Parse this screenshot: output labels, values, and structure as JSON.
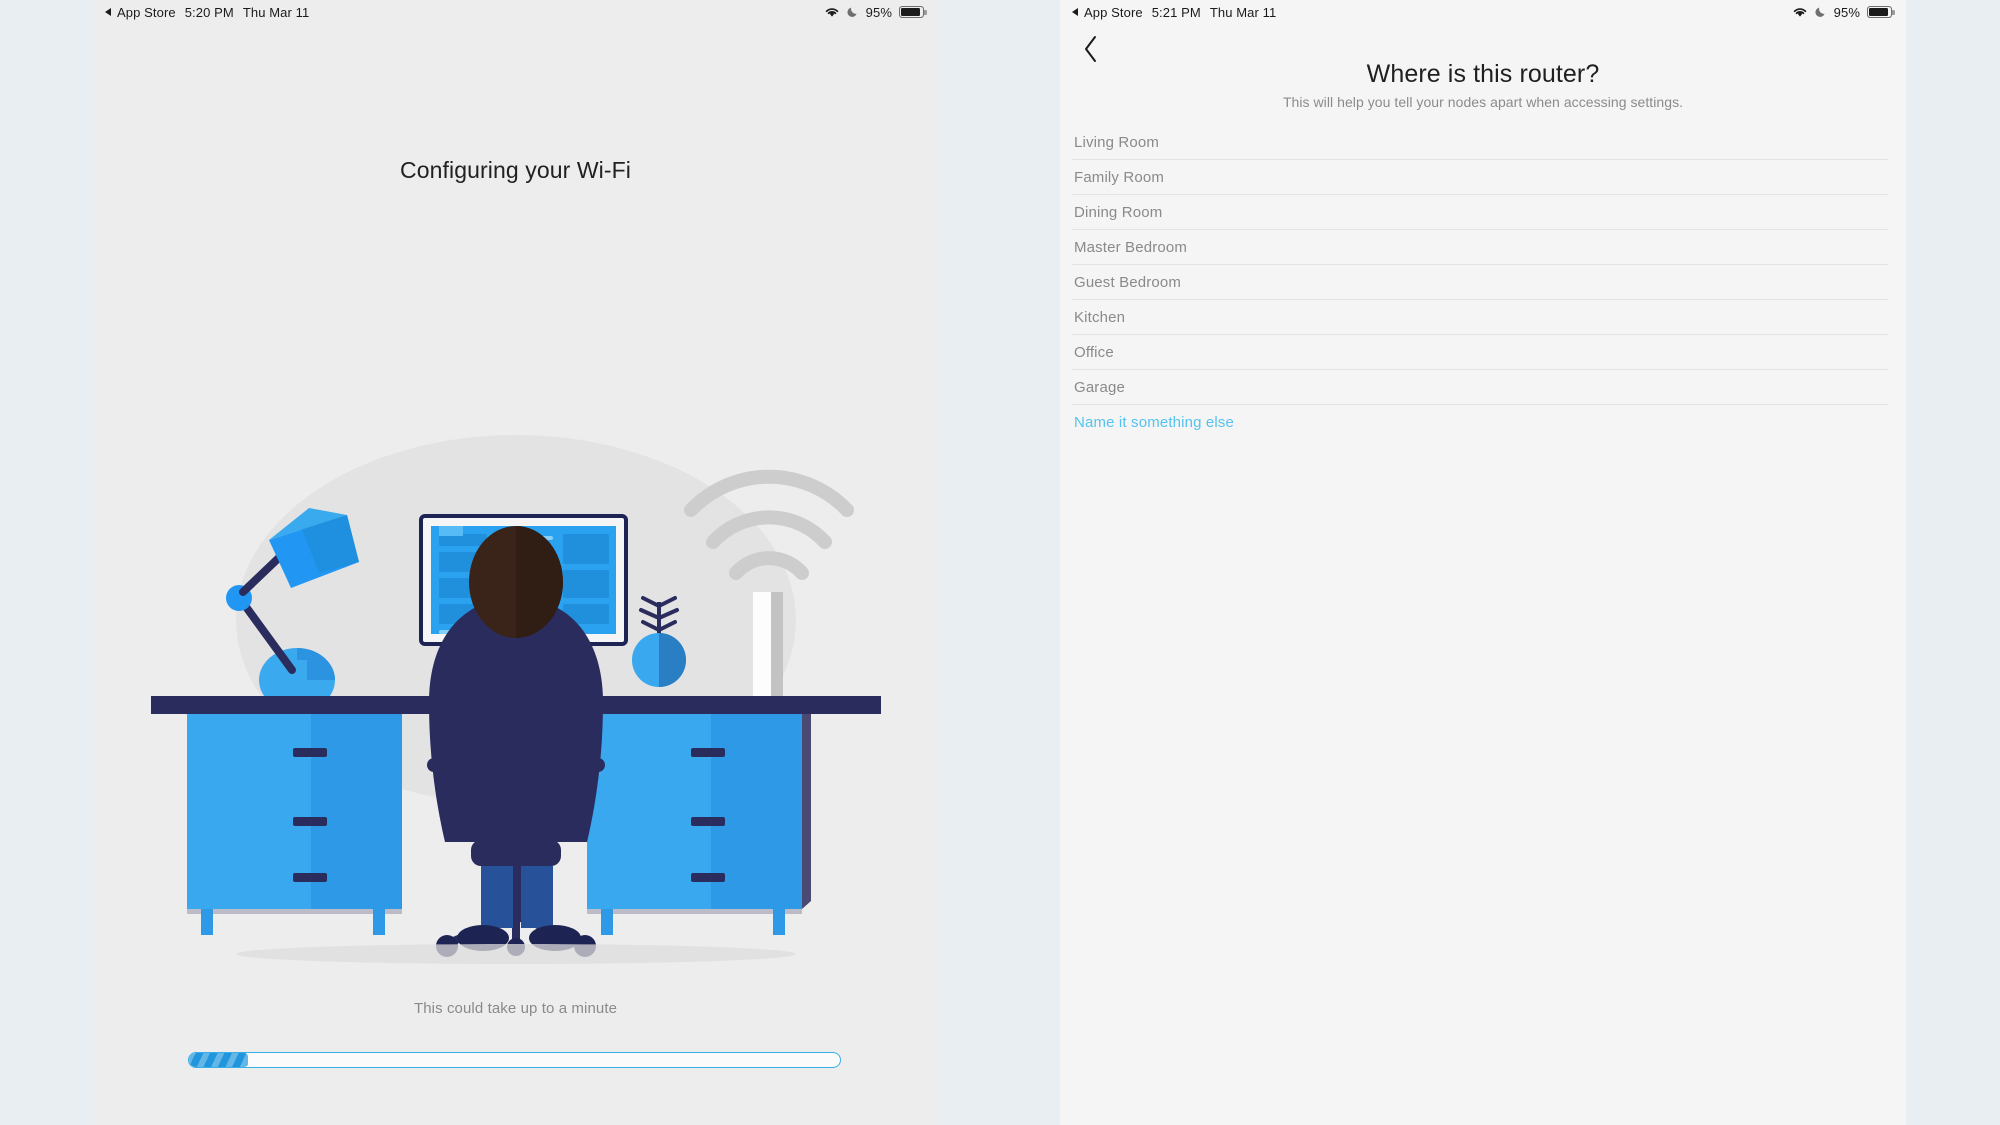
{
  "colors": {
    "accent_blue": "#54c3ef",
    "progress_blue": "#2196dd",
    "progress_border": "#36aee8",
    "text_primary": "#1f1f1f",
    "text_muted": "#8a8a8a",
    "pane_left_bg": "#ededed",
    "pane_right_bg": "#f5f5f5",
    "desktop_bg": "#e9eef3",
    "illustration_blue": "#2196f3",
    "illustration_navy": "#2b2c5e"
  },
  "left_pane": {
    "statusbar": {
      "back_app": "App Store",
      "time": "5:20 PM",
      "date": "Thu Mar 11",
      "battery_percent": "95%",
      "wifi_icon": "wifi-icon",
      "dnd_icon": "moon-icon",
      "battery_icon": "battery-icon"
    },
    "title": "Configuring your Wi-Fi",
    "subtext": "This could take up to a minute",
    "progress": {
      "percent": 9,
      "value_label": "9%"
    },
    "illustration": {
      "name": "person-at-desk-with-router-illustration",
      "elements": [
        "desk",
        "person",
        "office-chair",
        "monitor",
        "desk-lamp",
        "potted-plant",
        "router",
        "wifi-waves"
      ]
    }
  },
  "right_pane": {
    "statusbar": {
      "back_app": "App Store",
      "time": "5:21 PM",
      "date": "Thu Mar 11",
      "battery_percent": "95%",
      "wifi_icon": "wifi-icon",
      "dnd_icon": "moon-icon",
      "battery_icon": "battery-icon"
    },
    "back_button": "chevron-left-icon",
    "title": "Where is this router?",
    "subtitle": "This will help you tell your nodes apart when accessing settings.",
    "rooms": [
      {
        "label": "Living Room"
      },
      {
        "label": "Family Room"
      },
      {
        "label": "Dining Room"
      },
      {
        "label": "Master Bedroom"
      },
      {
        "label": "Guest Bedroom"
      },
      {
        "label": "Kitchen"
      },
      {
        "label": "Office"
      },
      {
        "label": "Garage"
      }
    ],
    "custom_option": "Name it something else"
  }
}
